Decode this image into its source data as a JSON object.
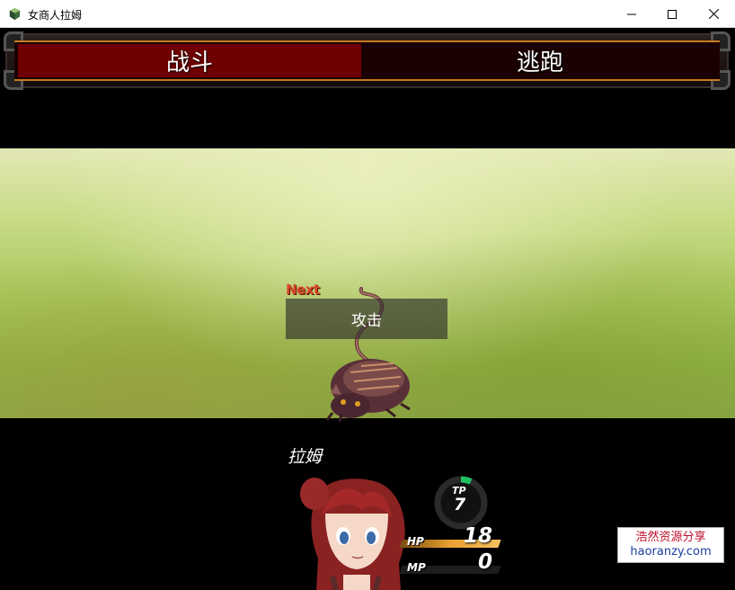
{
  "window": {
    "title": "女商人拉姆",
    "controls": [
      "minimize-icon",
      "maximize-icon",
      "close-icon"
    ]
  },
  "battle_commands": {
    "items": [
      {
        "label": "战斗",
        "selected": true
      },
      {
        "label": "逃跑",
        "selected": false
      }
    ]
  },
  "battlefield": {
    "next_label": "Next",
    "action_label": "攻击",
    "enemy_icon": "rat-icon"
  },
  "actor": {
    "name": "拉姆",
    "tp_label": "TP",
    "tp_value": "7",
    "hp_label": "HP",
    "hp_value": "18",
    "mp_label": "MP",
    "mp_value": "0",
    "tp_fill_fraction": 0.07,
    "hp_fill_fraction": 1.0,
    "mp_fill_fraction": 0.0
  },
  "watermark": {
    "line1": "浩然资源分享",
    "line2": "haoranzy.com"
  },
  "colors": {
    "selected_command_bg": "#6e0000",
    "command_border": "#c87a20",
    "hp_bar": "#e8a030",
    "tp_gauge": "#20c060"
  }
}
